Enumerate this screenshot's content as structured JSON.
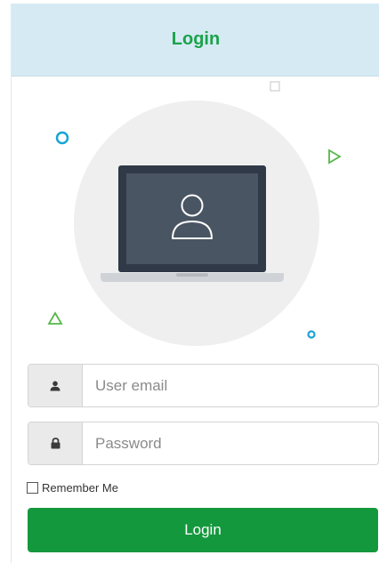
{
  "header": {
    "title": "Login"
  },
  "form": {
    "email_placeholder": "User email",
    "password_placeholder": "Password",
    "remember_label": "Remember Me",
    "remember_checked": false,
    "submit_label": "Login"
  },
  "icons": {
    "email_addon": "user-icon",
    "password_addon": "lock-icon",
    "illustration": "laptop-user-icon"
  },
  "colors": {
    "accent_green": "#14983d",
    "header_bg": "#d6eaf4",
    "title_green": "#1aa34a",
    "deco_cyan": "#1aa3d6",
    "deco_green": "#55b84a"
  }
}
